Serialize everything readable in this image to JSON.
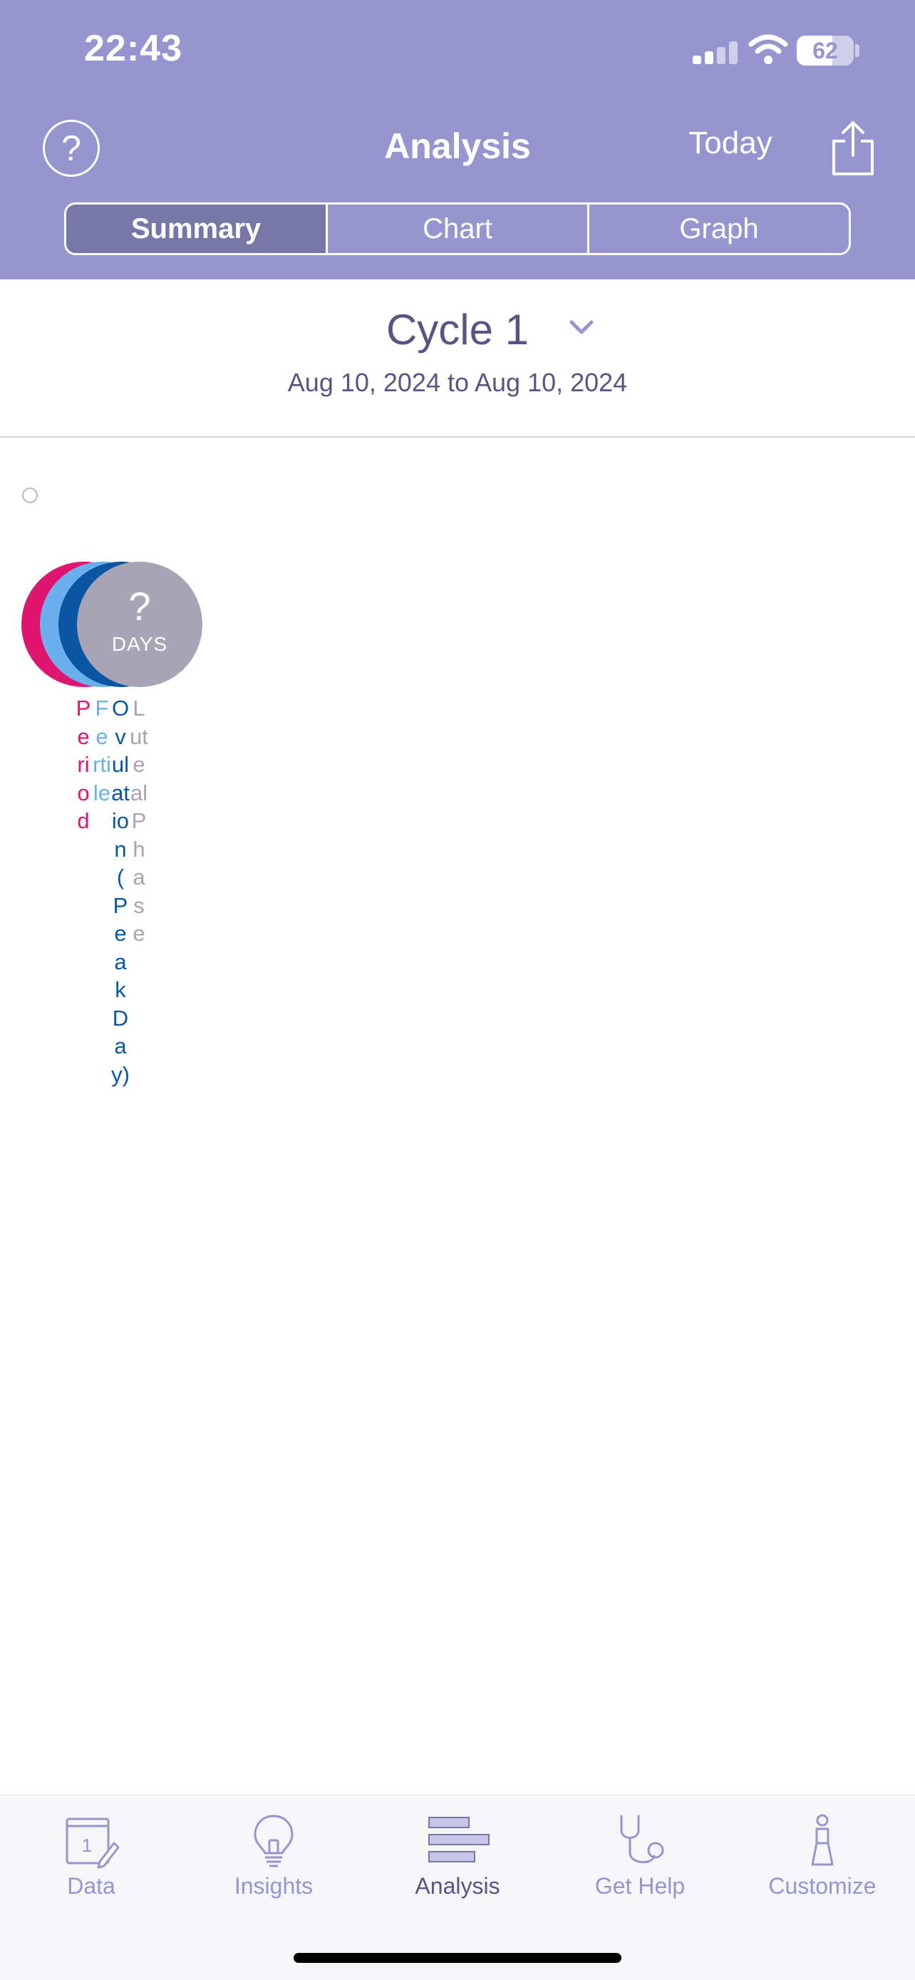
{
  "status_bar": {
    "time": "22:43",
    "battery": "62",
    "battery_level": 0.62
  },
  "header": {
    "title": "Analysis",
    "today_label": "Today",
    "icons": {
      "help": "help-circle-icon",
      "share": "share-icon"
    },
    "segments": [
      {
        "label": "Summary",
        "active": true
      },
      {
        "label": "Chart",
        "active": false
      },
      {
        "label": "Graph",
        "active": false
      }
    ]
  },
  "cycle": {
    "title": "Cycle 1",
    "range": "Aug 10, 2024 to Aug 10, 2024"
  },
  "summary": {
    "days_value": "?",
    "days_label": "DAYS",
    "phases": [
      {
        "label": "Period",
        "color": "#e0156f"
      },
      {
        "label": "Fertile",
        "color": "#6ab0ef"
      },
      {
        "label": "Ovulation (Peak Day)",
        "color": "#0a56a2"
      },
      {
        "label": "Luteal Phase",
        "color": "#a7a4b5"
      }
    ]
  },
  "tabbar": {
    "items": [
      {
        "label": "Data",
        "icon": "calendar-icon",
        "calendar_day": "1",
        "active": false
      },
      {
        "label": "Insights",
        "icon": "lightbulb-icon",
        "active": false
      },
      {
        "label": "Analysis",
        "icon": "bars-icon",
        "active": true
      },
      {
        "label": "Get Help",
        "icon": "stethoscope-icon",
        "active": false
      },
      {
        "label": "Customize",
        "icon": "person-icon",
        "active": false
      }
    ]
  },
  "colors": {
    "header_bg": "#9795cf",
    "active_segment": "#7876a8",
    "text_primary": "#5a5482"
  }
}
